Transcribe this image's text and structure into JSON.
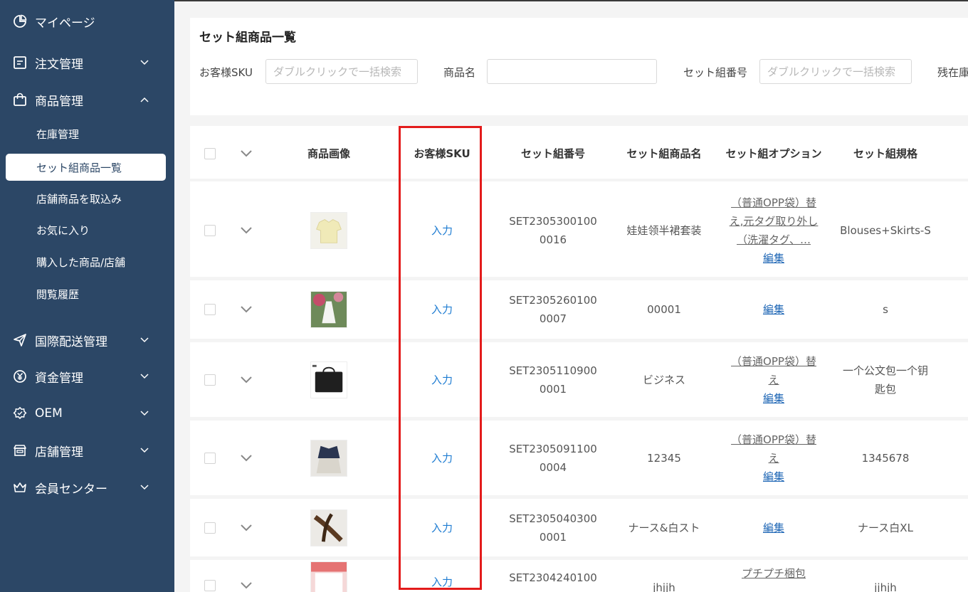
{
  "sidebar": {
    "items": [
      {
        "label": "マイページ",
        "icon": "pie-chart-icon"
      },
      {
        "label": "注文管理",
        "icon": "order-list-icon"
      },
      {
        "label": "商品管理",
        "icon": "shopping-bag-icon"
      },
      {
        "label": "国際配送管理",
        "icon": "paper-plane-icon"
      },
      {
        "label": "資金管理",
        "icon": "yen-icon"
      },
      {
        "label": "OEM",
        "icon": "badge-icon"
      },
      {
        "label": "店舗管理",
        "icon": "store-icon"
      },
      {
        "label": "会員センター",
        "icon": "crown-icon"
      }
    ],
    "sub_items": [
      {
        "label": "在庫管理"
      },
      {
        "label": "セット組商品一覧"
      },
      {
        "label": "店舗商品を取込み"
      },
      {
        "label": "お気に入り"
      },
      {
        "label": "購入した商品/店舗"
      },
      {
        "label": "閲覧履歴"
      }
    ]
  },
  "filter": {
    "title": "セット組商品一覧",
    "sku_label": "お客様SKU",
    "sku_placeholder": "ダブルクリックで一括検索",
    "name_label": "商品名",
    "name_value": "",
    "set_no_label": "セット組番号",
    "set_no_placeholder": "ダブルクリックで一括検索",
    "stock_label": "残在庫"
  },
  "table": {
    "headers": {
      "image": "商品画像",
      "sku": "お客様SKU",
      "set_no": "セット組番号",
      "set_name": "セット組商品名",
      "option": "セット組オプション",
      "spec": "セット組規格"
    },
    "edit_label": "編集",
    "rows": [
      {
        "sku": "入力",
        "set_no": "SET23053001000016",
        "name": "娃娃领半裙套装",
        "option": "（普通OPP袋）替え,元タグ取り外し（洗濯タグ、…",
        "spec": "Blouses+Skirts-S"
      },
      {
        "sku": "入力",
        "set_no": "SET23052601000007",
        "name": "00001",
        "option": "",
        "spec": "s"
      },
      {
        "sku": "入力",
        "set_no": "SET23051109000001",
        "name": "ビジネス",
        "option": "（普通OPP袋）替え",
        "spec": "一个公文包一个钥匙包"
      },
      {
        "sku": "入力",
        "set_no": "SET23050911000004",
        "name": "12345",
        "option": "（普通OPP袋）替え",
        "spec": "1345678"
      },
      {
        "sku": "入力",
        "set_no": "SET23050403000001",
        "name": "ナース&白スト",
        "option": "",
        "spec": "ナース白XL"
      },
      {
        "sku": "入力",
        "set_no": "SET2304240100",
        "name": "jhjjh",
        "option": "プチプチ梱包",
        "spec": "jjhjh"
      }
    ]
  },
  "colors": {
    "sidebar_bg": "#2c4766",
    "link": "#1e7cd2",
    "highlight": "#e31b1b"
  }
}
